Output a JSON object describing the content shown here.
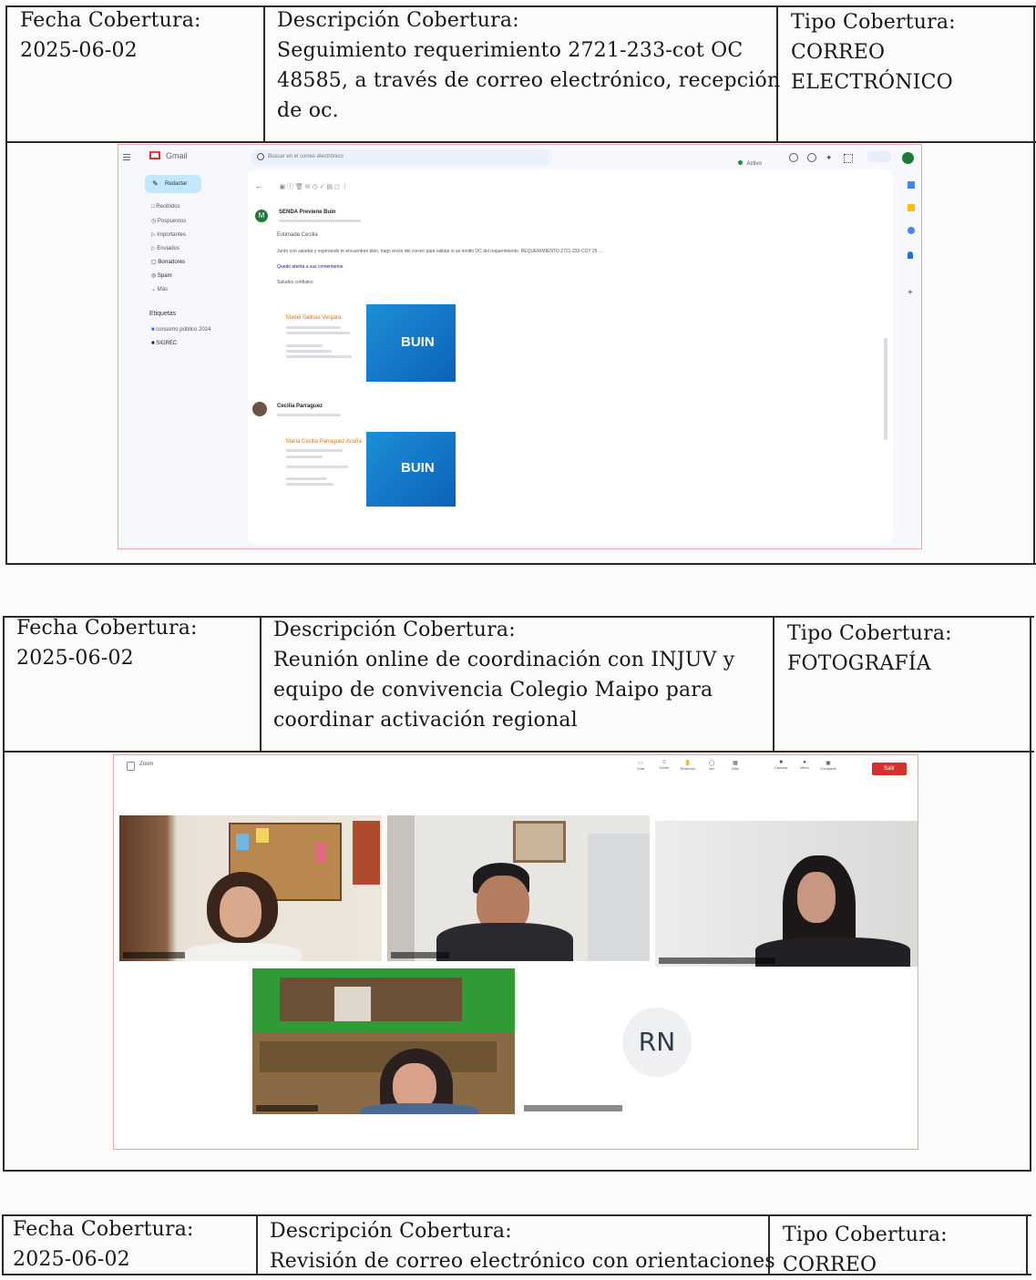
{
  "headers": {
    "fecha": "Fecha Cobertura:",
    "descripcion": "Descripción Cobertura:",
    "tipo": "Tipo Cobertura:"
  },
  "entries": [
    {
      "fecha": "2025-06-02",
      "descripcion_lines": [
        "Seguimiento requerimiento 2721-233-cot OC",
        "48585, a través de correo electrónico, recepción",
        "de oc."
      ],
      "tipo_lines": [
        "CORREO",
        "ELECTRÓNICO"
      ]
    },
    {
      "fecha": "2025-06-02",
      "descripcion_lines": [
        "Reunión online de coordinación con INJUV y",
        "equipo de convivencia Colegio Maipo para",
        "coordinar activación regional"
      ],
      "tipo_lines": [
        "FOTOGRAFÍA"
      ]
    },
    {
      "fecha": "2025-06-02",
      "descripcion_lines": [
        "Revisión de correo electrónico con orientaciones"
      ],
      "tipo_lines": [
        "CORREO"
      ]
    }
  ],
  "gmail": {
    "app_name": "Gmail",
    "search_placeholder": "Buscar en el correo electrónico",
    "compose": "Redactar",
    "status": "Activo",
    "nav": [
      "Recibidos",
      "Pospuestos",
      "Importantes",
      "Enviados",
      "Borradores",
      "Spam",
      "Más"
    ],
    "labels_title": "Etiquetas",
    "labels": [
      "consumo público 2024",
      "SIGREC"
    ],
    "message1_sender": "SENDA Previene Buin",
    "message1_greeting": "Estimada Cecilia",
    "message1_body": "Junto con saludar y esperando te encuentres bien, hago envío del correo para validar si se emitió OC del requerimiento. REQUERIMIENTO 2721-233-COT 25 ...",
    "message1_link": "Quedo atenta a sus comentarios",
    "message1_closing": "Saludos cordiales",
    "signature1_name": "Mabel Salinas Vergara",
    "message2_sender": "Cecilia Parraguez",
    "signature2_name": "María Cecilia Parraguez Acuña",
    "logo_text": "BUIN"
  },
  "meeting": {
    "window_label": "Zoom",
    "leave_label": "Salir",
    "avatar_initials": "RN",
    "toolbar_items": [
      "Chat",
      "Gente",
      "Reacción",
      "Ver",
      "Más",
      "Cámara",
      "Micro",
      "Compartir"
    ],
    "colors": {
      "leave": "#d9302f",
      "avatar_bg": "#eef0f2",
      "avatar_text": "#2f3a4a"
    }
  }
}
